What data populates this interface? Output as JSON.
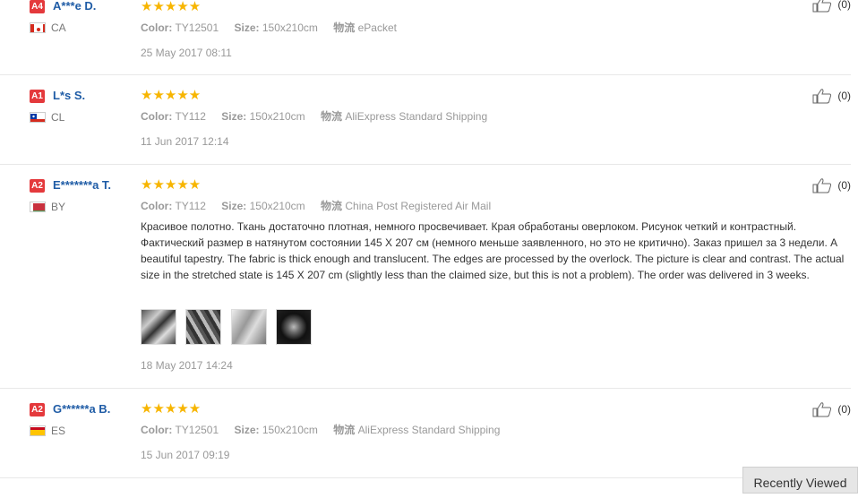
{
  "reviews": [
    {
      "badge": "A4",
      "name": "A***e D.",
      "country": "CA",
      "color_label": "Color:",
      "color": "TY12501",
      "size_label": "Size:",
      "size": "150x210cm",
      "ship_label": "物流",
      "shipping": "ePacket",
      "date": "25 May 2017 08:11",
      "likes": "(0)",
      "rating": "★★★★★"
    },
    {
      "badge": "A1",
      "name": "L*s S.",
      "country": "CL",
      "color_label": "Color:",
      "color": "TY112",
      "size_label": "Size:",
      "size": "150x210cm",
      "ship_label": "物流",
      "shipping": "AliExpress Standard Shipping",
      "date": "11 Jun 2017 12:14",
      "likes": "(0)",
      "rating": "★★★★★"
    },
    {
      "badge": "A2",
      "name": "E*******a T.",
      "country": "BY",
      "color_label": "Color:",
      "color": "TY112",
      "size_label": "Size:",
      "size": "150x210cm",
      "ship_label": "物流",
      "shipping": "China Post Registered Air Mail",
      "text": "Красивое полотно. Ткань достаточно плотная, немного просвечивает. Края обработаны оверлоком. Рисунок четкий и контрастный. Фактический размер в натянутом состоянии 145 X 207 см (немного меньше заявленного, но это не критично). Заказ пришел за 3 недели. A beautiful tapestry. The fabric is thick enough and translucent. The edges are processed by the overlock. The picture is clear and contrast. The actual size in the stretched state is 145 X 207 cm (slightly less than the claimed size, but this is not a problem). The order was delivered in 3 weeks.",
      "date": "18 May 2017 14:24",
      "likes": "(0)",
      "rating": "★★★★★"
    },
    {
      "badge": "A2",
      "name": "G******a B.",
      "country": "ES",
      "color_label": "Color:",
      "color": "TY12501",
      "size_label": "Size:",
      "size": "150x210cm",
      "ship_label": "物流",
      "shipping": "AliExpress Standard Shipping",
      "date": "15 Jun 2017 09:19",
      "likes": "(0)",
      "rating": "★★★★★"
    }
  ],
  "recently_viewed": "Recently Viewed",
  "colors": {
    "badge": "#e4393c",
    "username": "#1f5ca6",
    "star": "#f7b500"
  }
}
